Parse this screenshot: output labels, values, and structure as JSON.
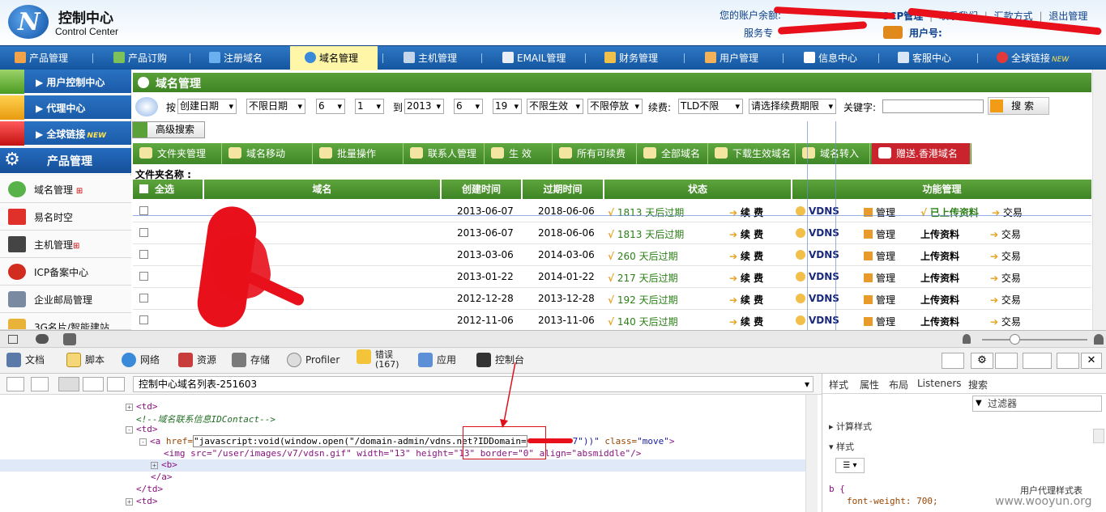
{
  "header": {
    "brand_cn": "控制中心",
    "brand_en": "Control Center",
    "logo_letter": "N",
    "balance_label": "您的账户余额:",
    "service_label": "服务专",
    "links": [
      "SCP管理",
      "联系我们",
      "汇款方式",
      "退出管理"
    ],
    "user_label": "用户号:"
  },
  "topnav": [
    {
      "label": "产品管理",
      "icon": "product-icon"
    },
    {
      "label": "产品订购",
      "icon": "cart-icon"
    },
    {
      "label": "注册域名",
      "icon": "register-icon"
    },
    {
      "label": "域名管理",
      "icon": "globe-icon",
      "active": true
    },
    {
      "label": "主机管理",
      "icon": "server-icon"
    },
    {
      "label": "EMAIL管理",
      "icon": "email-icon"
    },
    {
      "label": "财务管理",
      "icon": "finance-icon"
    },
    {
      "label": "用户管理",
      "icon": "user-icon"
    },
    {
      "label": "信息中心",
      "icon": "info-icon"
    },
    {
      "label": "客服中心",
      "icon": "support-icon"
    },
    {
      "label": "全球链接",
      "icon": "global-link-icon",
      "badge": "NEW"
    }
  ],
  "sidebar": {
    "heads": [
      "用户控制中心",
      "代理中心",
      "全球链接",
      "产品管理"
    ],
    "new_badge": "NEW",
    "items": [
      "域名管理",
      "易名时空",
      "主机管理",
      "ICP备案中心",
      "企业邮局管理",
      "3G名片/智能建站"
    ]
  },
  "main": {
    "title": "域名管理",
    "filters": {
      "sort_label": "按",
      "sort": "创建日期",
      "date_limit": "不限日期",
      "month_from": "6",
      "day_from": "1",
      "to_label": "到",
      "year_to": "2013",
      "month_to": "6",
      "day_to": "19",
      "effect": "不限生效",
      "stop": "不限停放",
      "renew_label": "续费:",
      "tld": "TLD不限",
      "renew_period": "请选择续费期限",
      "keyword_label": "关键字:",
      "search": "搜 索",
      "advanced": "高级搜索"
    },
    "toolbar": [
      "文件夹管理",
      "域名移动",
      "批量操作",
      "联系人管理",
      "生 效",
      "所有可续费",
      "全部域名",
      "下载生效域名",
      "域名转入",
      "赠送.香港域名"
    ],
    "folder_label": "文件夹名称 :",
    "table": {
      "headers": [
        "全选",
        "域名",
        "创建时间",
        "过期时间",
        "状态",
        "功能管理"
      ],
      "rows": [
        {
          "created": "2013-06-07",
          "expires": "2018-06-06",
          "days": "1813 天后过期",
          "upload": "已上传资料",
          "uploaded": true
        },
        {
          "created": "2013-06-07",
          "expires": "2018-06-06",
          "days": "1813 天后过期",
          "upload": "上传资料",
          "uploaded": false
        },
        {
          "created": "2013-03-06",
          "expires": "2014-03-06",
          "days": "260 天后过期",
          "upload": "上传资料",
          "uploaded": false
        },
        {
          "created": "2013-01-22",
          "expires": "2014-01-22",
          "days": "217 天后过期",
          "upload": "上传资料",
          "uploaded": false
        },
        {
          "created": "2012-12-28",
          "expires": "2013-12-28",
          "days": "192 天后过期",
          "upload": "上传资料",
          "uploaded": false
        },
        {
          "created": "2012-11-06",
          "expires": "2013-11-06",
          "days": "140 天后过期",
          "upload": "上传资料",
          "uploaded": false
        }
      ],
      "renew": "续 费",
      "vdns": "VDNS",
      "manage": "管理",
      "trade": "交易"
    }
  },
  "devtools": {
    "tabs": [
      "文档",
      "脚本",
      "网络",
      "资源",
      "存储",
      "Profiler",
      "错误\n(167)",
      "应用",
      "控制台"
    ],
    "breadcrumb": "控制中心域名列表-251603",
    "right_tabs": [
      "样式",
      "属性",
      "布局",
      "Listeners",
      "搜索"
    ],
    "filter_placeholder": "过滤器",
    "computed": "计算样式",
    "styles": "样式",
    "ua_label": "用户代理样式表",
    "css_selector": "b {",
    "css_rule": "font-weight: 700;",
    "code": {
      "td1": "<td>",
      "comment": "<!--域名联系信息IDContact-->",
      "td2": "<td>",
      "a_open": "<a ",
      "href_attr": "href=",
      "href_val": "\"javascript:void(window.open(\"/domain-admin/vdns.net?IDDomain=",
      "href_tail": "7\"))\"",
      "class_attr": " class=",
      "class_val": "\"move\"",
      "close": ">",
      "img_line": "<img src=\"/user/images/v7/vdsn.gif\" width=\"13\" height=\"13\" border=\"0\" align=\"absmiddle\"/>",
      "b_line": "<b>",
      "a_close": "</a>",
      "td_close": "</td>",
      "td3": "<td>"
    }
  },
  "watermark": "www.wooyun.org"
}
